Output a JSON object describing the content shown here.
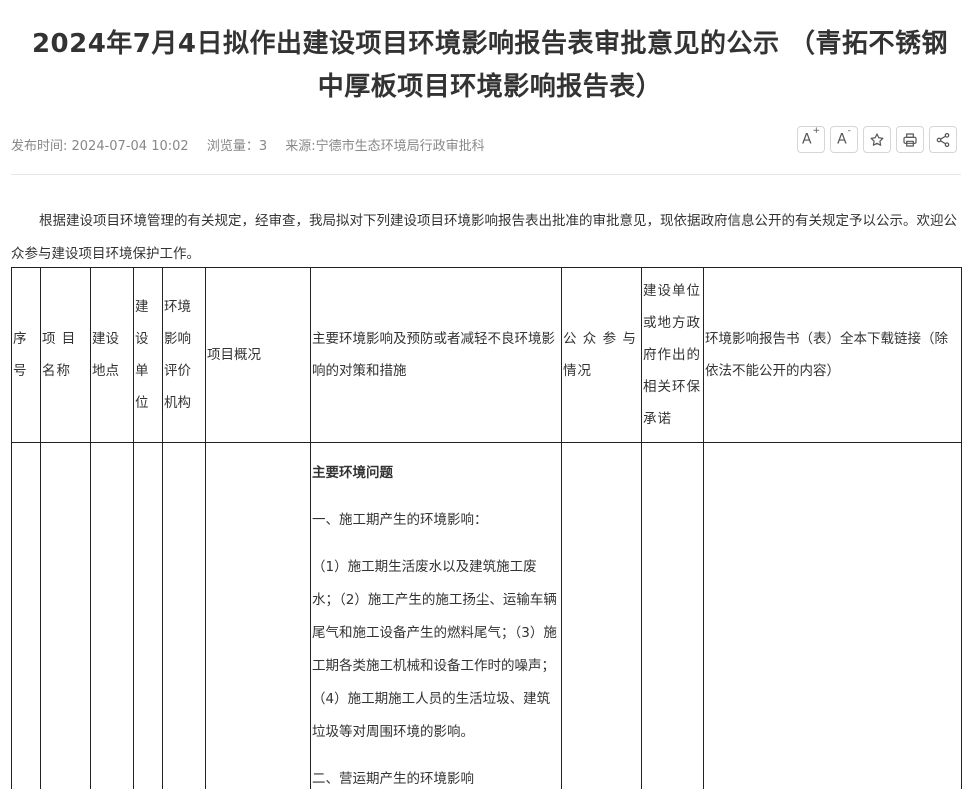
{
  "title": {
    "line1": "2024年7月4日拟作出建设项目环境影响报告表审批意见的公示 （青拓不锈钢",
    "line2": "中厚板项目环境影响报告表）"
  },
  "meta": {
    "publish_time": "发布时间: 2024-07-04 10:02",
    "views": "浏览量：3",
    "source": "来源:宁德市生态环境局行政审批科"
  },
  "tools": {
    "font_increase": "A",
    "font_decrease": "A",
    "font_increase_sup": "+",
    "font_decrease_sup": "-",
    "icons": [
      "font-increase-icon",
      "font-decrease-icon",
      "star-icon",
      "printer-icon",
      "share-icon"
    ]
  },
  "intro": "根据建设项目环境管理的有关规定，经审查，我局拟对下列建设项目环境影响报告表出批准的审批意见，现依据政府信息公开的有关规定予以公示。欢迎公众参与建设项目环境保护工作。",
  "table": {
    "headers": [
      "序号",
      "项 目 名称",
      "建设地点",
      "建设单位",
      "环境影响评价机构",
      "项目概况",
      "主要环境影响及预防或者减轻不良环境影响的对策和措施",
      "公 众 参 与 情况",
      "建设单位或地方政府作出的相关环保承诺",
      "环境影响报告书（表）全本下载链接（除依法不能公开的内容）"
    ],
    "measures": {
      "heading": "主要环境问题",
      "section1": "一、施工期产生的环境影响：",
      "paragraph1": "（1）施工期生活废水以及建筑施工废水；（2）施工产生的施工扬尘、运输车辆尾气和施工设备产生的燃料尾气；（3）施工期各类施工机械和设备工作时的噪声；（4）施工期施工人员的生活垃圾、建筑垃圾等对周围环境的影响。",
      "section2": "二、营运期产生的环境影响"
    }
  }
}
